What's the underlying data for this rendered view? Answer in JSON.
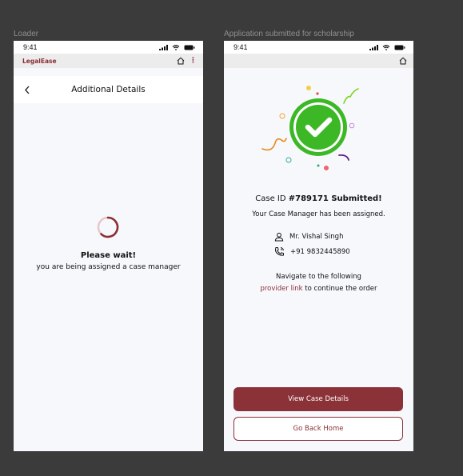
{
  "colors": {
    "brand": "#8b2f36",
    "success_green": "#3cb826",
    "canvas": "#3b3b3b"
  },
  "frames": {
    "loader": {
      "label": "Loader",
      "status_time": "9:41",
      "brand": "LegalEase",
      "icons": [
        "signal-icon",
        "wifi-icon",
        "battery-icon",
        "home-icon",
        "kebab-menu-icon",
        "back-chevron-icon",
        "loading-spinner-icon"
      ],
      "header_title": "Additional Details",
      "wait_title": "Please wait!",
      "wait_subtitle": "you are being assigned a case manager"
    },
    "submitted": {
      "label": "Application submitted for scholarship",
      "status_time": "9:41",
      "icons": [
        "signal-icon",
        "wifi-icon",
        "battery-icon",
        "home-icon",
        "check-circle-icon",
        "person-icon",
        "phone-icon"
      ],
      "case_prefix": "Case ID ",
      "case_id": "#789171 Submitted!",
      "assigned_text": "Your Case Manager has been assigned.",
      "manager_name": "Mr. Vishal Singh",
      "manager_phone": "+91 9832445890",
      "nav_line1": "Navigate to the following",
      "nav_link": "provider link",
      "nav_line2": " to continue the order",
      "primary_button": "View Case Details",
      "secondary_button": "Go Back Home"
    }
  }
}
